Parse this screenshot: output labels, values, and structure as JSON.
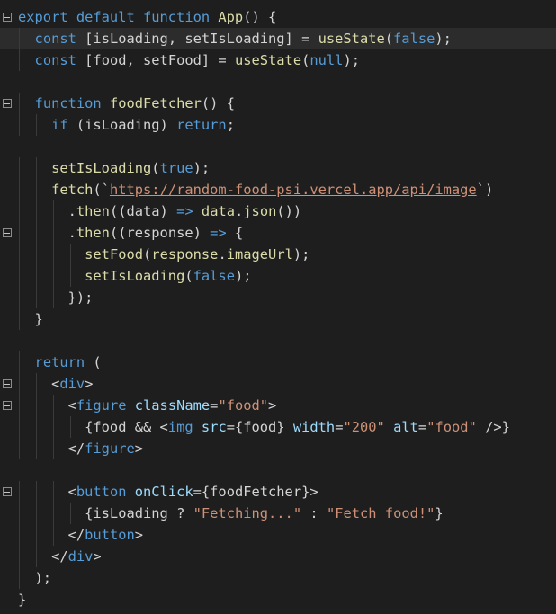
{
  "editor": {
    "language": "jsx",
    "active_line": 2,
    "fold_lines": [
      1,
      5,
      11,
      18,
      19,
      23
    ]
  },
  "colors": {
    "background": "#1e1e1e",
    "active_line": "#2c2c2c",
    "keyword": "#569cd6",
    "function": "#dcdcaa",
    "variable": "#9cdcfe",
    "string": "#ce9178",
    "number": "#b5cea8",
    "text": "#d4d4d4"
  },
  "lines": [
    [
      [
        "kw",
        "export default function "
      ],
      [
        "fn",
        "App"
      ],
      [
        "txt",
        "() {"
      ]
    ],
    [
      [
        "txt",
        "  "
      ],
      [
        "kw",
        "const "
      ],
      [
        "txt",
        "[isLoading, setIsLoading] = "
      ],
      [
        "fn",
        "useState"
      ],
      [
        "txt",
        "("
      ],
      [
        "bool",
        "false"
      ],
      [
        "txt",
        ");"
      ]
    ],
    [
      [
        "txt",
        "  "
      ],
      [
        "kw",
        "const "
      ],
      [
        "txt",
        "[food, setFood] = "
      ],
      [
        "fn",
        "useState"
      ],
      [
        "txt",
        "("
      ],
      [
        "bool",
        "null"
      ],
      [
        "txt",
        ");"
      ]
    ],
    [],
    [
      [
        "txt",
        "  "
      ],
      [
        "kw",
        "function "
      ],
      [
        "fn",
        "foodFetcher"
      ],
      [
        "txt",
        "() {"
      ]
    ],
    [
      [
        "txt",
        "    "
      ],
      [
        "kw",
        "if "
      ],
      [
        "txt",
        "(isLoading) "
      ],
      [
        "kw",
        "return"
      ],
      [
        "txt",
        ";"
      ]
    ],
    [],
    [
      [
        "txt",
        "    "
      ],
      [
        "fn",
        "setIsLoading"
      ],
      [
        "txt",
        "("
      ],
      [
        "bool",
        "true"
      ],
      [
        "txt",
        ");"
      ]
    ],
    [
      [
        "txt",
        "    "
      ],
      [
        "fn",
        "fetch"
      ],
      [
        "txt",
        "(`"
      ],
      [
        "url",
        "https://random-food-psi.vercel.app/api/image"
      ],
      [
        "txt",
        "`)"
      ]
    ],
    [
      [
        "txt",
        "      ."
      ],
      [
        "fn",
        "then"
      ],
      [
        "txt",
        "((data) "
      ],
      [
        "kw",
        "=>"
      ],
      [
        "txt",
        " "
      ],
      [
        "fn",
        "data"
      ],
      [
        "txt",
        "."
      ],
      [
        "fn",
        "json"
      ],
      [
        "txt",
        "())"
      ]
    ],
    [
      [
        "txt",
        "      ."
      ],
      [
        "fn",
        "then"
      ],
      [
        "txt",
        "((response) "
      ],
      [
        "kw",
        "=>"
      ],
      [
        "txt",
        " {"
      ]
    ],
    [
      [
        "txt",
        "        "
      ],
      [
        "fn",
        "setFood"
      ],
      [
        "txt",
        "("
      ],
      [
        "fn",
        "response"
      ],
      [
        "txt",
        "."
      ],
      [
        "fn",
        "imageUrl"
      ],
      [
        "txt",
        ");"
      ]
    ],
    [
      [
        "txt",
        "        "
      ],
      [
        "fn",
        "setIsLoading"
      ],
      [
        "txt",
        "("
      ],
      [
        "bool",
        "false"
      ],
      [
        "txt",
        ");"
      ]
    ],
    [
      [
        "txt",
        "      });"
      ]
    ],
    [
      [
        "txt",
        "  }"
      ]
    ],
    [],
    [
      [
        "txt",
        "  "
      ],
      [
        "kw",
        "return "
      ],
      [
        "txt",
        "("
      ]
    ],
    [
      [
        "txt",
        "    <"
      ],
      [
        "tag",
        "div"
      ],
      [
        "txt",
        ">"
      ]
    ],
    [
      [
        "txt",
        "      <"
      ],
      [
        "tag",
        "figure "
      ],
      [
        "attr",
        "className"
      ],
      [
        "txt",
        "="
      ],
      [
        "str",
        "\"food\""
      ],
      [
        "txt",
        ">"
      ]
    ],
    [
      [
        "txt",
        "        {food "
      ],
      [
        "op",
        "&&"
      ],
      [
        "txt",
        " <"
      ],
      [
        "tag",
        "img "
      ],
      [
        "attr",
        "src"
      ],
      [
        "txt",
        "={food} "
      ],
      [
        "attr",
        "width"
      ],
      [
        "txt",
        "="
      ],
      [
        "str",
        "\"200\""
      ],
      [
        "txt",
        " "
      ],
      [
        "attr",
        "alt"
      ],
      [
        "txt",
        "="
      ],
      [
        "str",
        "\"food\""
      ],
      [
        "txt",
        " />}"
      ]
    ],
    [
      [
        "txt",
        "      </"
      ],
      [
        "tag",
        "figure"
      ],
      [
        "txt",
        ">"
      ]
    ],
    [],
    [
      [
        "txt",
        "      <"
      ],
      [
        "tag",
        "button "
      ],
      [
        "attr",
        "onClick"
      ],
      [
        "txt",
        "={foodFetcher}>"
      ]
    ],
    [
      [
        "txt",
        "        {isLoading "
      ],
      [
        "op",
        "?"
      ],
      [
        "txt",
        " "
      ],
      [
        "str",
        "\"Fetching...\""
      ],
      [
        "txt",
        " "
      ],
      [
        "op",
        ":"
      ],
      [
        "txt",
        " "
      ],
      [
        "str",
        "\"Fetch food!\""
      ],
      [
        "txt",
        "}"
      ]
    ],
    [
      [
        "txt",
        "      </"
      ],
      [
        "tag",
        "button"
      ],
      [
        "txt",
        ">"
      ]
    ],
    [
      [
        "txt",
        "    </"
      ],
      [
        "tag",
        "div"
      ],
      [
        "txt",
        ">"
      ]
    ],
    [
      [
        "txt",
        "  );"
      ]
    ],
    [
      [
        "txt",
        "}"
      ]
    ]
  ]
}
